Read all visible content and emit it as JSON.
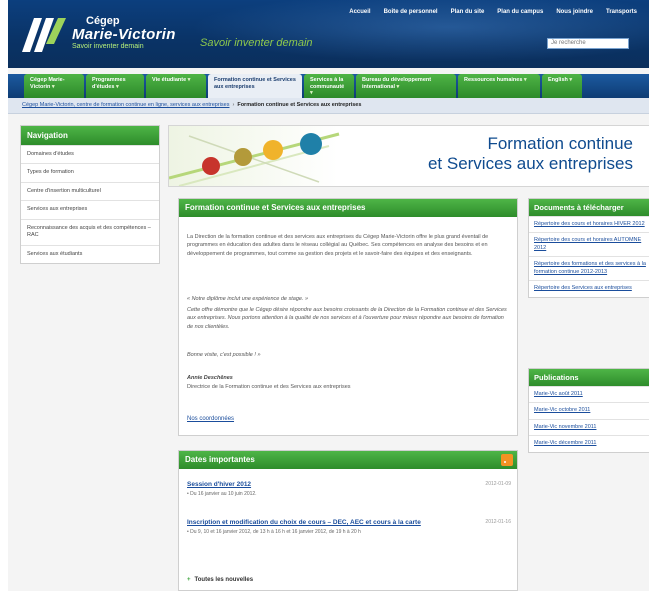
{
  "header": {
    "top_links": [
      "Accueil",
      "Boîte de personnel",
      "Plan du site",
      "Plan du campus",
      "Nous joindre",
      "Transports"
    ],
    "logo_line1": "Cégep",
    "logo_line2": "Marie-Victorin",
    "logo_line3": "Savoir inventer demain",
    "slogan": "Savoir inventer demain",
    "search_placeholder": "Je recherche"
  },
  "mainnav": {
    "items": [
      {
        "label": "Cégep Marie-Victorin",
        "active": false
      },
      {
        "label": "Programmes d'études",
        "active": false
      },
      {
        "label": "Vie étudiante",
        "active": false
      },
      {
        "label": "Formation continue et Services aux entreprises",
        "active": true
      },
      {
        "label": "Services à la communauté",
        "active": false
      },
      {
        "label": "Bureau du développement international",
        "active": false
      },
      {
        "label": "Ressources humaines",
        "active": false
      },
      {
        "label": "English",
        "active": false
      }
    ]
  },
  "breadcrumb": {
    "link": "Cégep Marie-Victorin, centre de formation continue en ligne, services aux entreprises",
    "current": "Formation continue et Services aux entreprises"
  },
  "sidebar": {
    "title": "Navigation",
    "items": [
      "Domaines d'études",
      "Types de formation",
      "Centre d'insertion multiculturel",
      "Services aux entreprises",
      "Reconnaissance des acquis et des compétences – RAC",
      "Services aux étudiants"
    ]
  },
  "banner": {
    "title_line1": "Formation continue",
    "title_line2": "et Services aux entreprises"
  },
  "content": {
    "heading": "Formation continue et Services aux entreprises",
    "paragraph1": "La Direction de la formation continue et des services aux entreprises du Cégep Marie-Victorin offre le plus grand éventail de programmes en éducation des adultes dans le réseau collégial au Québec. Ses compétences en analyse des besoins et en développement de programmes, tout comme sa gestion des projets et le savoir-faire des équipes et des enseignants.",
    "quote_line1": "« Notre diplôme inclut une expérience de stage. »",
    "paragraph2": "Cette offre démontre que le Cégep désire répondre aux besoins croissants de la Direction de la Formation continue et des Services aux entreprises. Nous portons attention à la qualité de nos services et à l'ouverture pour mieux répondre aux besoins de formation de nos clientèles.",
    "quote_end": "Bonne visite, c'est possible ! »",
    "signature_name": "Annie Deschênes",
    "signature_title": "Directrice de la Formation continue et des Services aux entreprises",
    "more_link": "Nos coordonnées"
  },
  "dates": {
    "heading": "Dates importantes",
    "events": [
      {
        "title": "Session d'hiver 2012",
        "date": "2012-01-09",
        "desc": "• Du 16 janvier au 10 juin 2012."
      },
      {
        "title": "Inscription et modification du choix de cours – DEC, AEC et cours à la carte",
        "date": "2012-01-16",
        "desc": "• Du 9, 10 et 16 janvier 2012, de 13 h à 16 h et 16 janvier 2012, de 19 h à 20 h"
      }
    ],
    "all_news": "Toutes les nouvelles"
  },
  "downloads": {
    "heading": "Documents à télécharger",
    "links": [
      "Répertoire des cours et horaires HIVER 2012",
      "Répertoire des cours et horaires AUTOMNE 2012",
      "Répertoire des formations et des services à la formation continue 2012-2013",
      "Répertoire des Services aux entreprises"
    ]
  },
  "publications": {
    "heading": "Publications",
    "links": [
      "Marie-Vic août 2011",
      "Marie-Vic octobre 2011",
      "Marie-Vic novembre 2011",
      "Marie-Vic décembre 2011"
    ]
  },
  "colors": {
    "header_blue": "#0c3f7e",
    "green": "#3aa33a",
    "link_blue": "#1a4d9c",
    "banner_blue": "#0f4b8f"
  }
}
